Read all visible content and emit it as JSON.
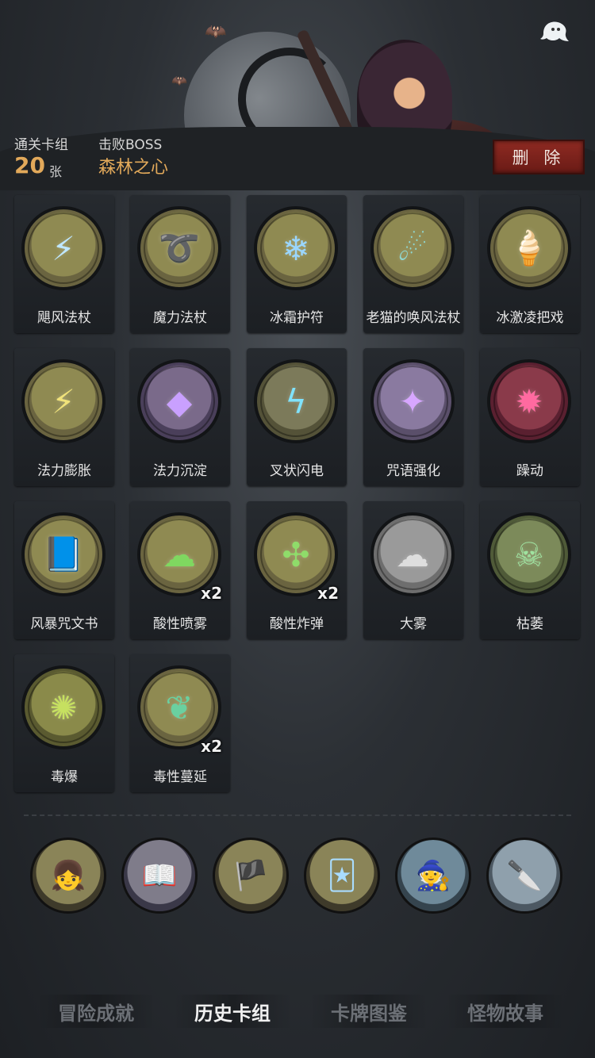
{
  "header": {
    "cleared_label": "通关卡组",
    "cleared_count": "20",
    "cleared_unit": "张",
    "boss_label": "击败BOSS",
    "boss_name": "森林之心",
    "delete_label": "删 除",
    "ghost_icon": "ghost-icon"
  },
  "cards": [
    {
      "name": "飓风法杖",
      "icon": "storm-staff-icon",
      "mult": ""
    },
    {
      "name": "魔力法杖",
      "icon": "mana-staff-icon",
      "mult": ""
    },
    {
      "name": "冰霜护符",
      "icon": "frost-amulet-icon",
      "mult": ""
    },
    {
      "name": "老猫的唤风法杖",
      "icon": "cat-wind-staff-icon",
      "mult": ""
    },
    {
      "name": "冰激凌把戏",
      "icon": "ice-cream-icon",
      "mult": ""
    },
    {
      "name": "法力膨胀",
      "icon": "mana-surge-icon",
      "mult": ""
    },
    {
      "name": "法力沉淀",
      "icon": "mana-settle-icon",
      "mult": ""
    },
    {
      "name": "叉状闪电",
      "icon": "forked-lightning-icon",
      "mult": ""
    },
    {
      "name": "咒语强化",
      "icon": "spell-boost-icon",
      "mult": ""
    },
    {
      "name": "躁动",
      "icon": "frenzy-icon",
      "mult": ""
    },
    {
      "name": "风暴咒文书",
      "icon": "storm-book-icon",
      "mult": ""
    },
    {
      "name": "酸性喷雾",
      "icon": "acid-spray-icon",
      "mult": "x2"
    },
    {
      "name": "酸性炸弹",
      "icon": "acid-bomb-icon",
      "mult": "x2"
    },
    {
      "name": "大雾",
      "icon": "fog-icon",
      "mult": ""
    },
    {
      "name": "枯萎",
      "icon": "wither-icon",
      "mult": ""
    },
    {
      "name": "毒爆",
      "icon": "poison-burst-icon",
      "mult": ""
    },
    {
      "name": "毒性蔓延",
      "icon": "poison-spread-icon",
      "mult": "x2"
    }
  ],
  "characters": [
    {
      "icon": "character-girl-icon"
    },
    {
      "icon": "character-book-icon"
    },
    {
      "icon": "character-pirate-icon"
    },
    {
      "icon": "character-cards-icon"
    },
    {
      "icon": "character-mage-icon"
    },
    {
      "icon": "character-knife-icon"
    }
  ],
  "tabs": [
    {
      "label": "冒险成就",
      "active": false
    },
    {
      "label": "历史卡组",
      "active": true
    },
    {
      "label": "卡牌图鉴",
      "active": false
    },
    {
      "label": "怪物故事",
      "active": false
    }
  ],
  "colors": {
    "accent_gold": "#e2a95a",
    "delete_red": "#8e2a22"
  }
}
